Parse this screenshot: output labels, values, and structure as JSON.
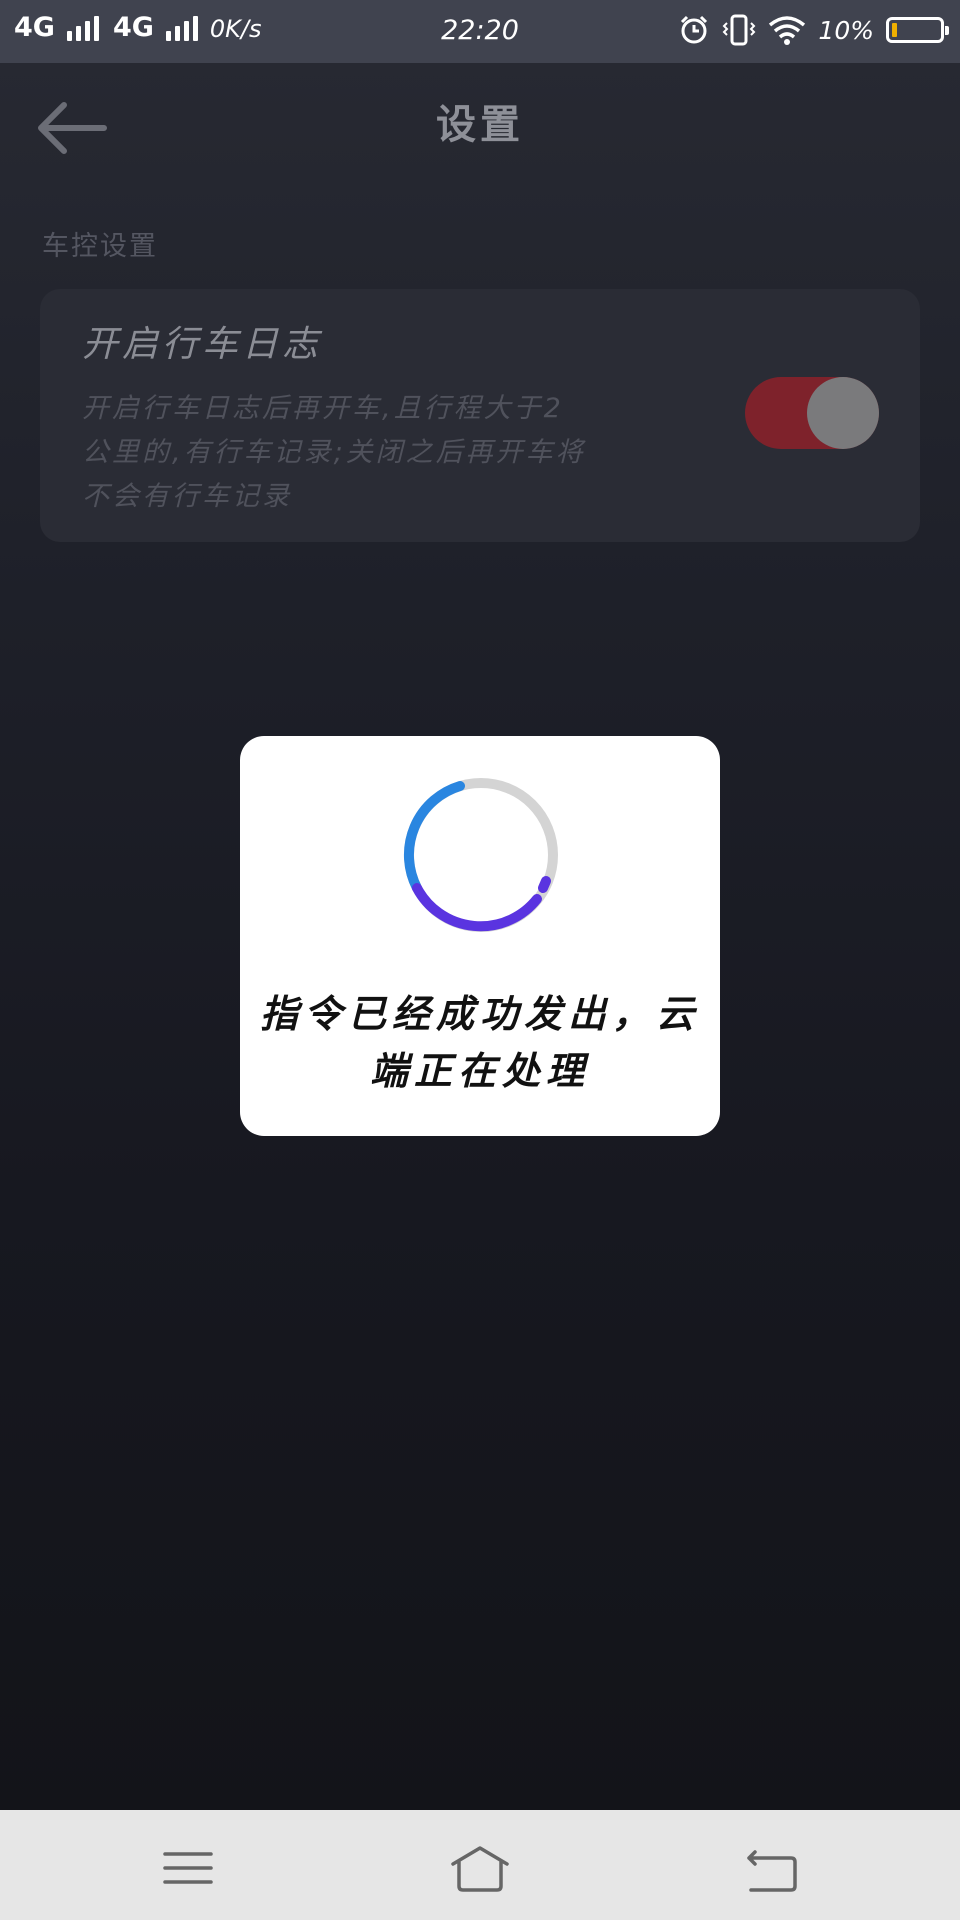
{
  "status_bar": {
    "network_1": "4G",
    "network_2": "4G",
    "net_speed": "0K/s",
    "time": "22:20",
    "battery_percent": "10%",
    "battery_level": 0.1,
    "icons": [
      "signal-icon",
      "alarm-icon",
      "vibrate-icon",
      "wifi-icon",
      "battery-icon"
    ]
  },
  "header": {
    "back_icon": "back-arrow-icon",
    "title": "设置"
  },
  "section": {
    "label": "车控设置"
  },
  "setting_card": {
    "title": "开启行车日志",
    "description_lines": [
      "开启行车日志后再开车,且行程大于2",
      "公里的,有行车记录;关闭之后再开车将",
      "不会有行车记录"
    ],
    "toggle_on": true
  },
  "dialog": {
    "spinner_icon": "loading-spinner-icon",
    "message_lines": [
      "指令已经成功发出，云",
      "端正在处理"
    ]
  },
  "nav_bar": {
    "icons": [
      "menu-icon",
      "home-icon",
      "back-icon"
    ]
  },
  "colors": {
    "status_bar_bg": "#40434f",
    "toggle_on": "#7e222b",
    "spinner_blue": "#2a86e0",
    "spinner_purple": "#5a34e0",
    "navbar_bg": "#e6e6e6"
  }
}
